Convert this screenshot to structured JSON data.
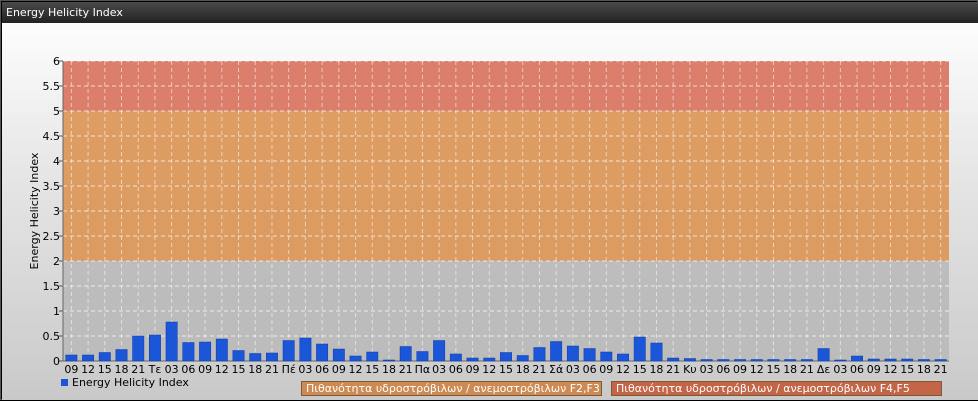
{
  "window": {
    "title": "Energy Helicity Index"
  },
  "colors": {
    "series": "#1b56d9",
    "band_low": "#b9b9b9",
    "band_mid": "#dc9553",
    "band_high": "#d8715d"
  },
  "legend": {
    "series_label": "Energy Helicity Index",
    "band_f2f3": "Πιθανότητα υδροστρόβιλων / ανεμοστρόβιλων F2,F3",
    "band_f4f5": "Πιθανότητα υδροστρόβιλων / ανεμοστρόβιλων F4,F5"
  },
  "chart_data": {
    "type": "bar",
    "ylabel": "Energy Helicity Index",
    "ylim": [
      0,
      6
    ],
    "yticks": [
      "0",
      "0.5",
      "1",
      "1.5",
      "2",
      "2.5",
      "3",
      "3.5",
      "4",
      "4.5",
      "5",
      "5.5",
      "6"
    ],
    "grid": true,
    "bands": [
      {
        "from": 0,
        "to": 2,
        "color": "#b9b9b9"
      },
      {
        "from": 2,
        "to": 5,
        "color": "#dc9553"
      },
      {
        "from": 5,
        "to": 6,
        "color": "#d8715d"
      }
    ],
    "categories": [
      "09",
      "12",
      "15",
      "18",
      "21",
      "Τε",
      "03",
      "06",
      "09",
      "12",
      "15",
      "18",
      "21",
      "Πέ",
      "03",
      "06",
      "09",
      "12",
      "15",
      "18",
      "21",
      "Πα",
      "03",
      "06",
      "09",
      "12",
      "15",
      "18",
      "21",
      "Σά",
      "03",
      "06",
      "09",
      "12",
      "15",
      "18",
      "21",
      "Κυ",
      "03",
      "06",
      "09",
      "12",
      "15",
      "18",
      "21",
      "Δε",
      "03",
      "06",
      "09",
      "12",
      "15",
      "18",
      "21"
    ],
    "series": [
      {
        "name": "Energy Helicity Index",
        "values": [
          0.12,
          0.12,
          0.17,
          0.23,
          0.5,
          0.52,
          0.78,
          0.37,
          0.38,
          0.44,
          0.21,
          0.15,
          0.16,
          0.41,
          0.46,
          0.34,
          0.24,
          0.1,
          0.18,
          0.02,
          0.29,
          0.19,
          0.41,
          0.14,
          0.06,
          0.06,
          0.17,
          0.11,
          0.27,
          0.39,
          0.3,
          0.25,
          0.18,
          0.14,
          0.48,
          0.36,
          0.06,
          0.05,
          0.03,
          0.03,
          0.03,
          0.03,
          0.03,
          0.03,
          0.03,
          0.25,
          0.02,
          0.1,
          0.04,
          0.04,
          0.04,
          0.03,
          0.03,
          0.03,
          0.04
        ]
      }
    ]
  }
}
